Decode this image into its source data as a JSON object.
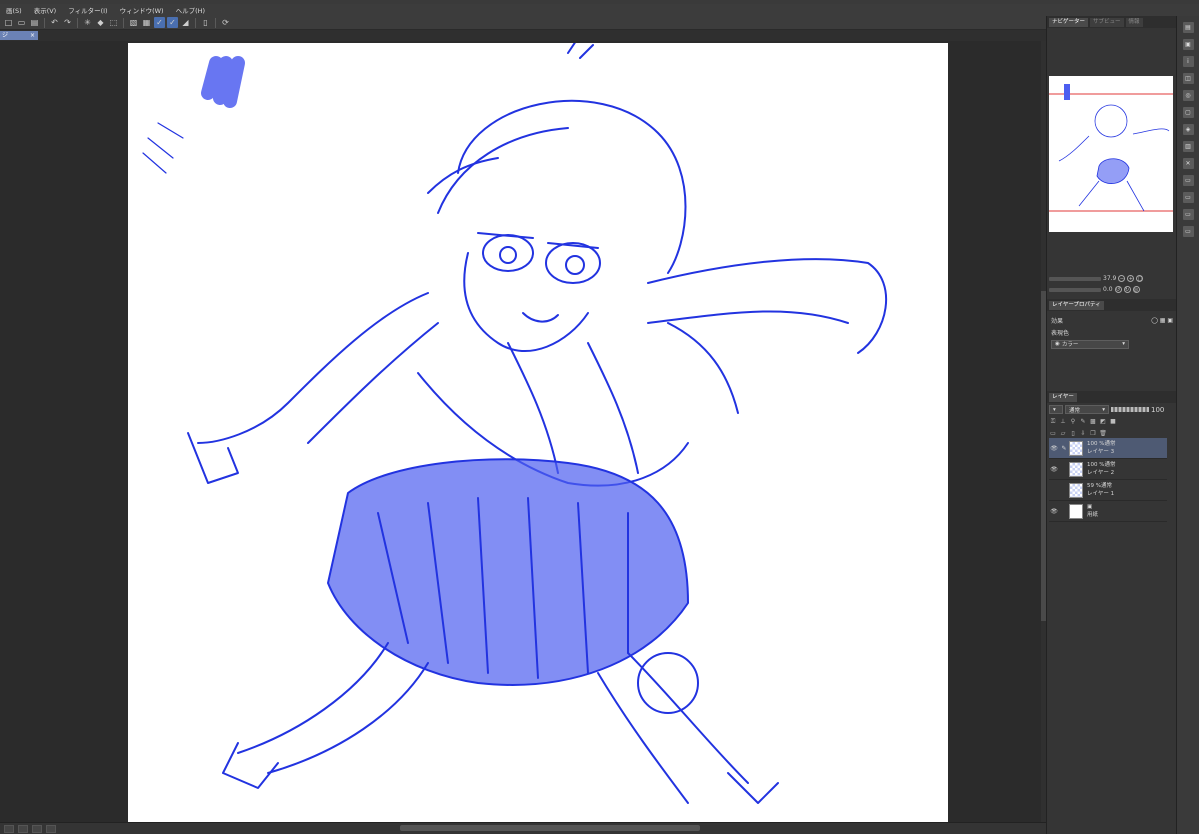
{
  "menu": {
    "items": [
      "画(S)",
      "表示(V)",
      "フィルター(I)",
      "ウィンドウ(W)",
      "ヘルプ(H)"
    ]
  },
  "toolbar": {
    "icons": [
      "new-file-icon",
      "open-icon",
      "save-icon",
      "undo-icon",
      "redo-icon",
      "clear-icon",
      "fill-icon",
      "transform-icon",
      "pen-check-icon",
      "pen-check-icon-2",
      "ruler-icon",
      "device-icon",
      "settings-icon"
    ]
  },
  "document_tab": {
    "label": "ジ",
    "close": "×"
  },
  "status": {
    "zoom_boxes": [
      "",
      "",
      "",
      ""
    ]
  },
  "navigator": {
    "tabs": [
      "ナビゲーター",
      "サブビュー",
      "情報"
    ],
    "zoom": "37.9",
    "rotation": "0.0"
  },
  "properties": {
    "tab": "レイヤープロパティ",
    "effect_label": "効果",
    "display_color_label": "表現色",
    "display_color_value": "カラー"
  },
  "layers": {
    "tab": "レイヤー",
    "blend_mode": "通常",
    "opacity": "100",
    "items": [
      {
        "mode": "100 %通常",
        "name": "レイヤー 3",
        "selected": true,
        "visible": true,
        "thumb": "check"
      },
      {
        "mode": "100 %通常",
        "name": "レイヤー 2",
        "selected": false,
        "visible": true,
        "thumb": "check"
      },
      {
        "mode": "59 %通常",
        "name": "レイヤー 1",
        "selected": false,
        "visible": false,
        "thumb": "check"
      },
      {
        "mode": "",
        "name": "用紙",
        "selected": false,
        "visible": true,
        "thumb": "white"
      }
    ]
  },
  "colors": {
    "accent": "#4a6fb0",
    "sketch": "#2233e0",
    "sketch_fill": "#4d5ef0"
  }
}
